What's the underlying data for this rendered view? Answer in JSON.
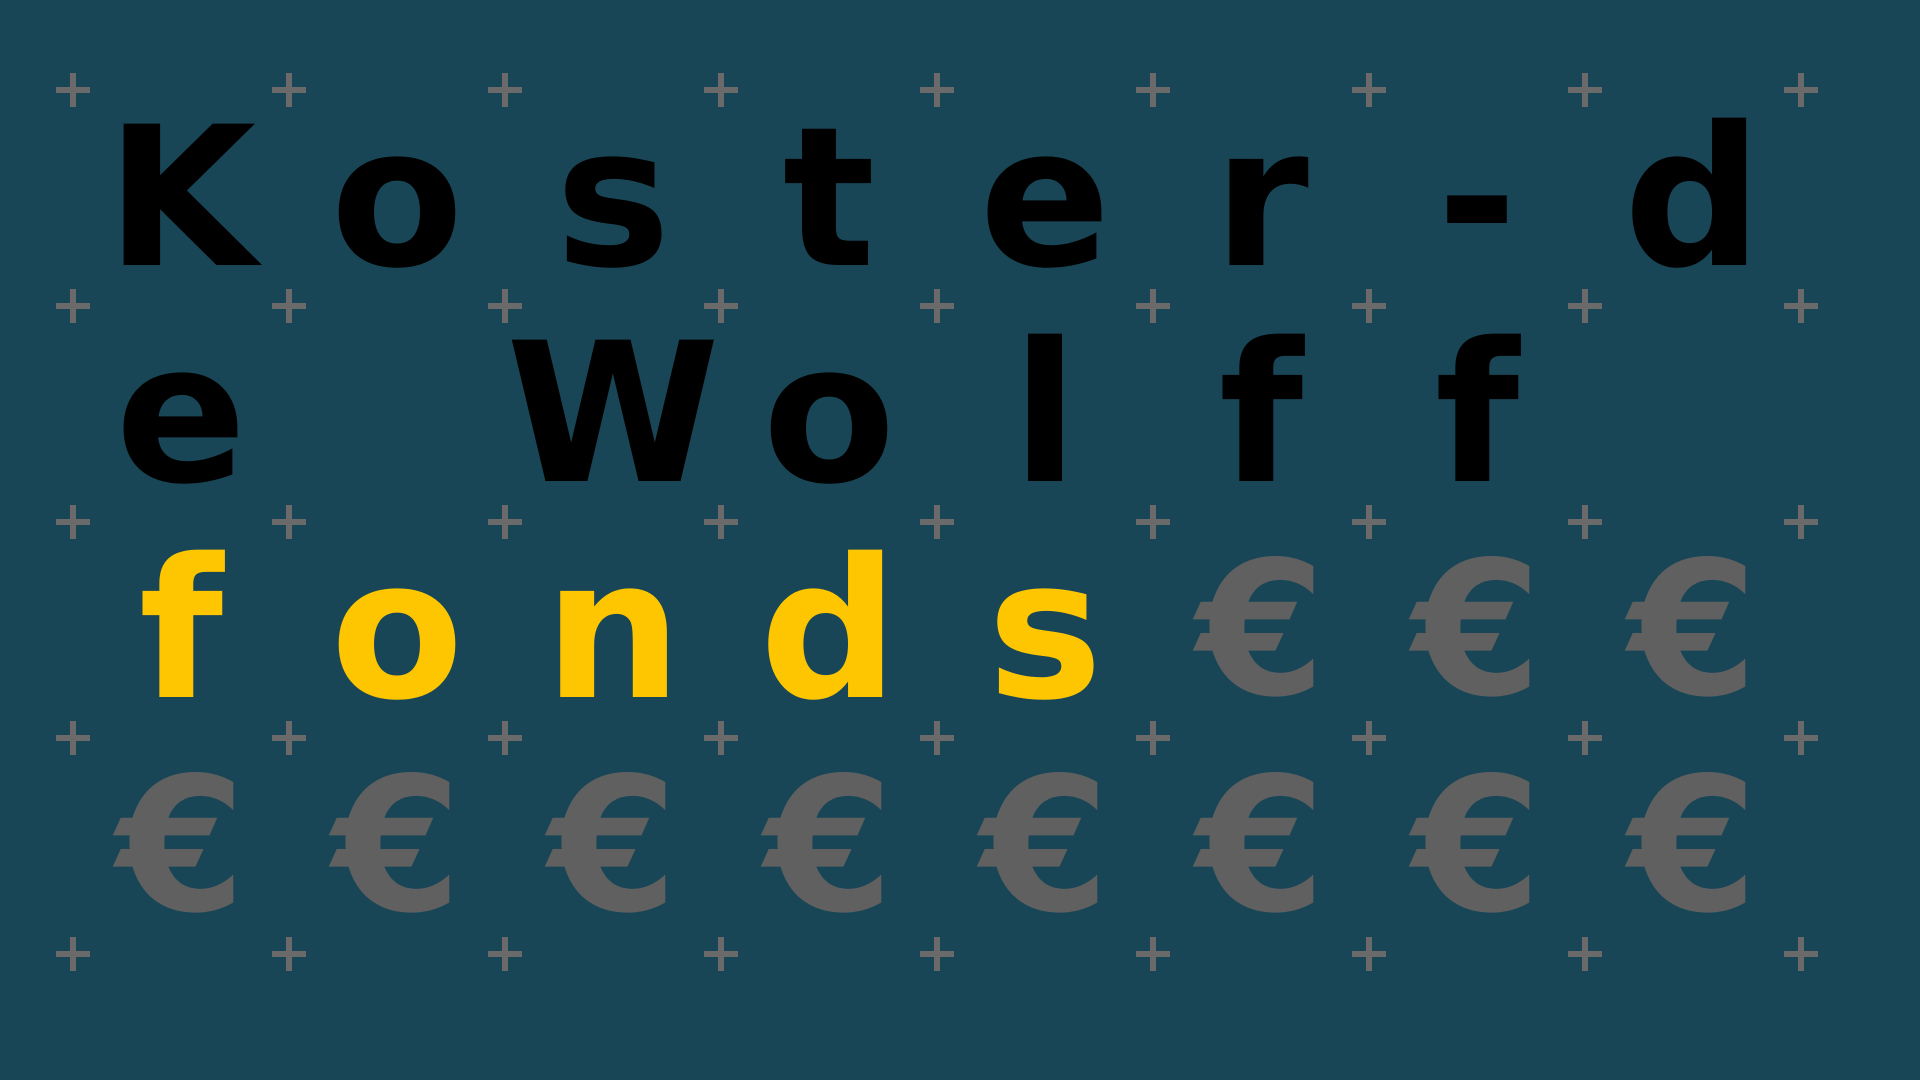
{
  "colors": {
    "background": "#194656",
    "plus": "#6a6a6a",
    "title": "#000000",
    "highlight": "#fdc600",
    "euro": "#606060"
  },
  "decoration": {
    "plus_icon": "plus-icon",
    "euro_icon": "euro-sign-icon",
    "euro_glyph": "€"
  },
  "lines": [
    {
      "text": "Koster-d",
      "role": "title"
    },
    {
      "text": "e Wolff",
      "role": "title"
    },
    {
      "text": "fonds",
      "role": "highlight"
    }
  ]
}
